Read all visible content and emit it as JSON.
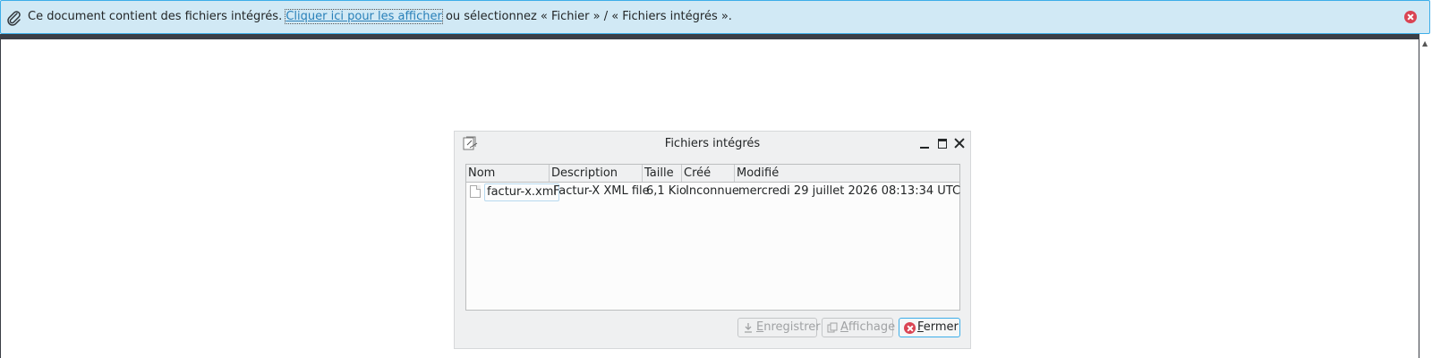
{
  "notification": {
    "text_before": "Ce document contient des fichiers intégrés. ",
    "link": "Cliquer ici pour les afficher",
    "text_after": " ou sélectionnez « Fichier » / « Fichiers intégrés ».",
    "icon": "paperclip-icon"
  },
  "dialog": {
    "title": "Fichiers intégrés",
    "columns": [
      "Nom",
      "Description",
      "Taille",
      "Créé",
      "Modifié"
    ],
    "rows": [
      {
        "name": "factur-x.xml",
        "description": "Factur-X XML file",
        "size": "6,1 Kio",
        "created": "Inconnue",
        "modified": "mercredi 29 juillet 2026 08:13:34 UTC"
      }
    ],
    "buttons": {
      "save_rest": "nregistrer",
      "save_access": "E",
      "view_rest": "ffichage",
      "view_access": "A",
      "close_rest": "ermer",
      "close_access": "F"
    }
  },
  "colors": {
    "notification_bg": "#d1e9f5",
    "accent": "#3daee9",
    "danger": "#da4453"
  }
}
